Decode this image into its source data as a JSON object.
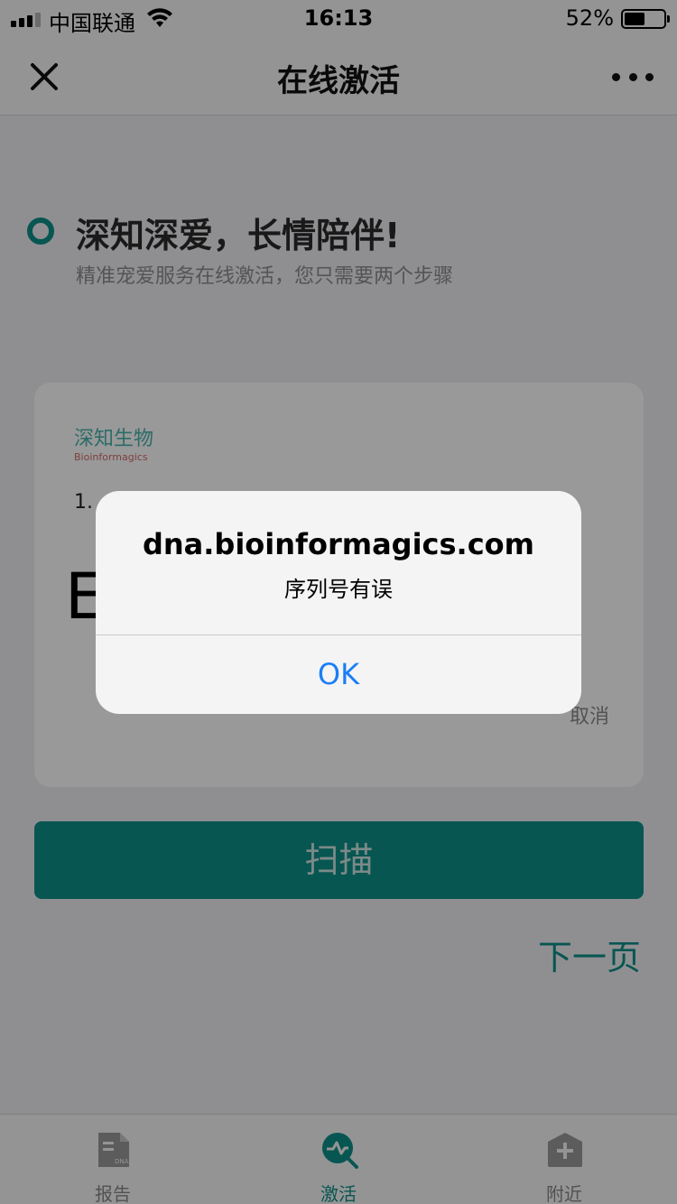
{
  "status_bar": {
    "carrier": "中国联通",
    "time": "16:13",
    "battery": "52%",
    "battery_level": 0.52,
    "signal_icon": "signal-bars-icon",
    "wifi_icon": "wifi-icon"
  },
  "nav": {
    "title": "在线激活",
    "close_icon": "close-icon",
    "more_icon": "more-dots-icon"
  },
  "intro": {
    "headline": "深知深爱，长情陪伴!",
    "subline": "精准宠爱服务在线激活，您只需要两个步骤"
  },
  "card": {
    "brand_cn": "深知生物",
    "brand_en": "Bioinformagics",
    "step_text": "1.",
    "serial_value": "E",
    "cancel": "取消"
  },
  "scan_button": "扫描",
  "next_link": "下一页",
  "tabs": [
    {
      "label": "报告",
      "icon": "report-dna-icon",
      "active": false
    },
    {
      "label": "激活",
      "icon": "activate-pulse-icon",
      "active": true
    },
    {
      "label": "附近",
      "icon": "nearby-plus-icon",
      "active": false
    }
  ],
  "alert": {
    "title": "dna.bioinformagics.com",
    "message": "序列号有误",
    "ok": "OK"
  },
  "colors": {
    "accent": "#0e8f88",
    "link_blue": "#1a7ef5",
    "brand_red": "#d56a6a"
  }
}
